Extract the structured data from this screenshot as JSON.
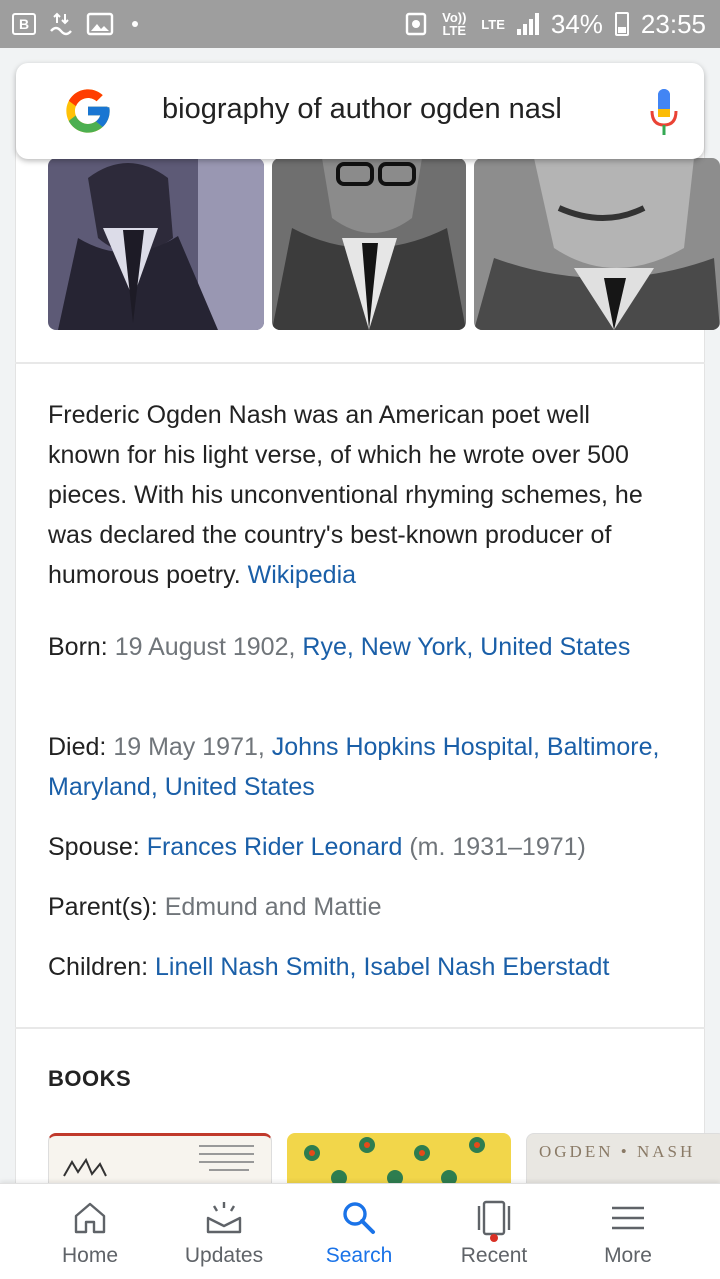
{
  "status_bar": {
    "network_label": "Vo)) LTE",
    "lte_label": "LTE",
    "battery": "34%",
    "time": "23:55"
  },
  "search": {
    "query": "biography of author ogden nasl"
  },
  "summary": {
    "text": "Frederic Ogden Nash was an American poet well known for his light verse, of which he wrote over 500 pieces. With his unconventional rhyming schemes, he was declared the country's best-known producer of humorous poetry.",
    "source": "Wikipedia"
  },
  "facts": {
    "born_label": "Born:",
    "born_date": "19 August 1902,",
    "born_place": "Rye, New York, United States",
    "died_label": "Died:",
    "died_date": "19 May 1971,",
    "died_place": "Johns Hopkins Hospital, Baltimore, Maryland, United States",
    "spouse_label": "Spouse:",
    "spouse_name": "Frances Rider Leonard",
    "spouse_years": "(m. 1931–1971)",
    "parents_label": "Parent(s):",
    "parents_value": "Edmund and Mattie",
    "children_label": "Children:",
    "children_value": "Linell Nash Smith, Isabel Nash Eberstadt"
  },
  "books": {
    "title": "BOOKS",
    "book3_cover_text": "OGDEN • NASH"
  },
  "bottom_nav": {
    "items": [
      {
        "label": "Home",
        "icon": "home-icon"
      },
      {
        "label": "Updates",
        "icon": "updates-icon"
      },
      {
        "label": "Search",
        "icon": "search-icon"
      },
      {
        "label": "Recent",
        "icon": "recent-icon"
      },
      {
        "label": "More",
        "icon": "menu-icon"
      }
    ],
    "active": "Search"
  },
  "colors": {
    "link": "#1a5fa8",
    "active_nav": "#1a73e8",
    "status_bar": "#9e9e9e"
  }
}
